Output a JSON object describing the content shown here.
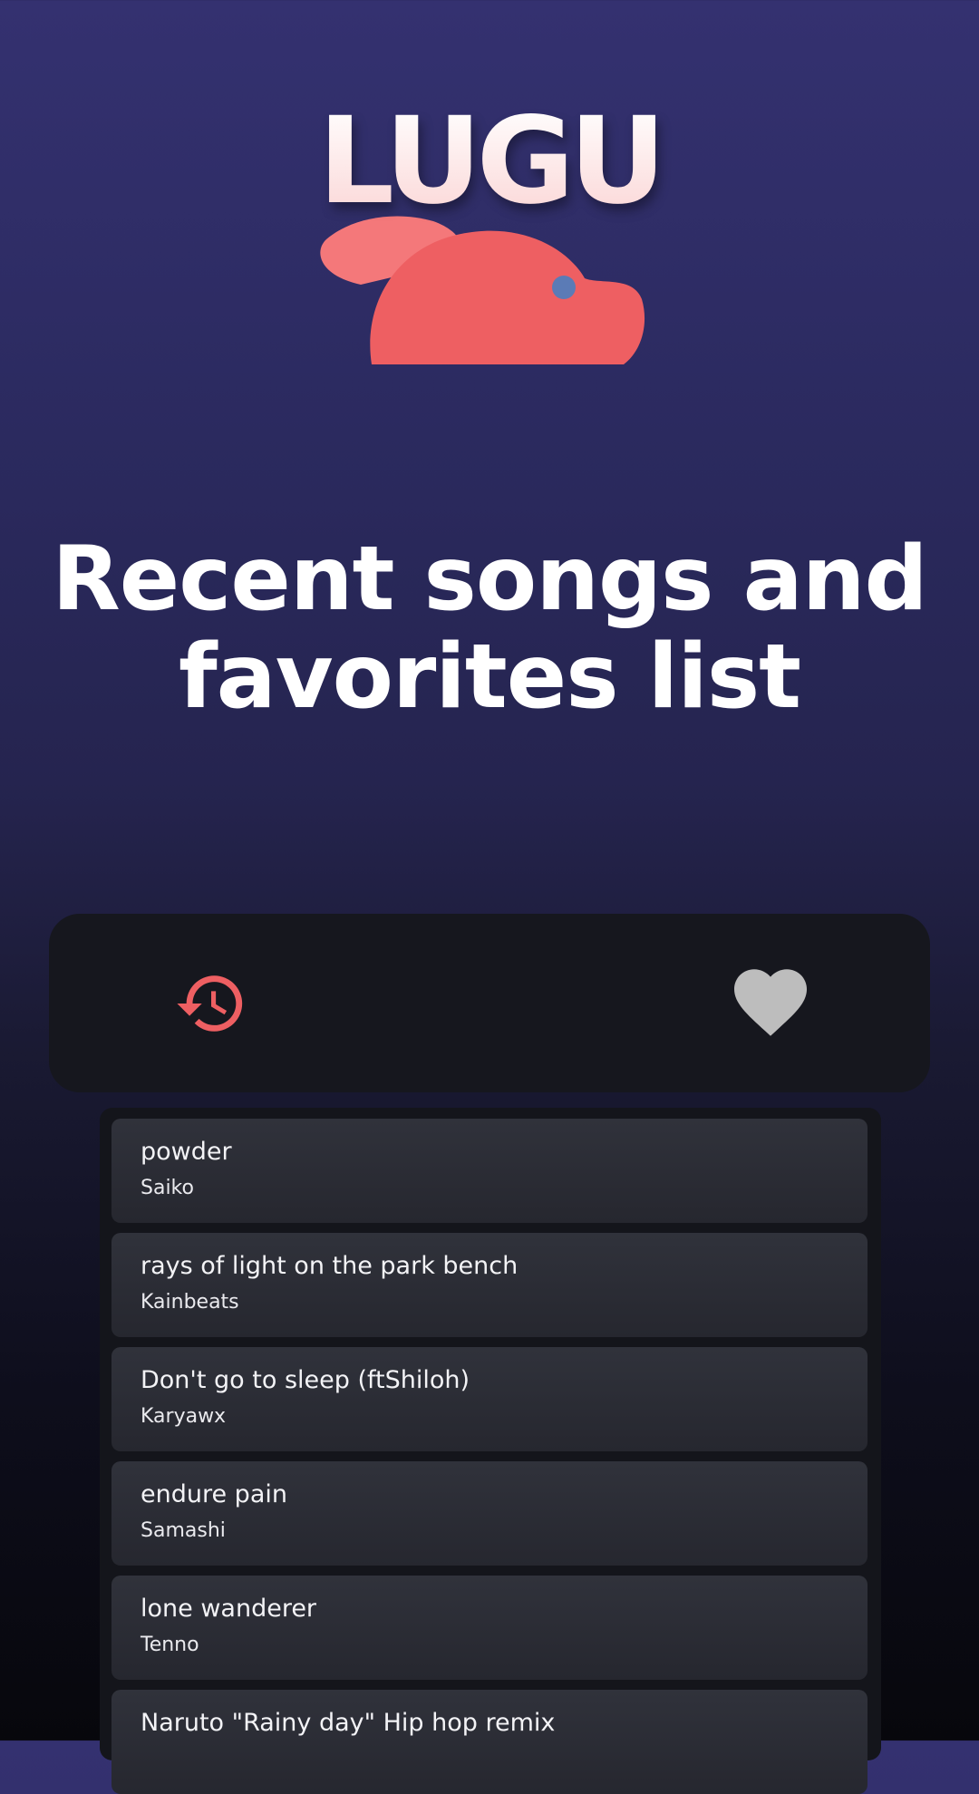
{
  "app": {
    "logo_text": "LUGU"
  },
  "headline": {
    "line1": "Recent songs and",
    "line2": "favorites list"
  },
  "tabs": {
    "recent_icon": "history-icon",
    "favorites_icon": "heart-icon",
    "active_color": "#ee5f62",
    "inactive_color": "#bdbdbd"
  },
  "songs": [
    {
      "title": "powder",
      "artist": "Saiko"
    },
    {
      "title": "rays of light on the park bench",
      "artist": "Kainbeats"
    },
    {
      "title": "Don't go to sleep (ftShiloh)",
      "artist": "Karyawx"
    },
    {
      "title": "endure pain",
      "artist": "Samashi"
    },
    {
      "title": "lone wanderer",
      "artist": "Tenno"
    },
    {
      "title": "Naruto \"Rainy day\" Hip hop remix",
      "artist": ""
    }
  ],
  "colors": {
    "brand_coral": "#ee5f62",
    "mascot_eye": "#5b7bb6"
  }
}
